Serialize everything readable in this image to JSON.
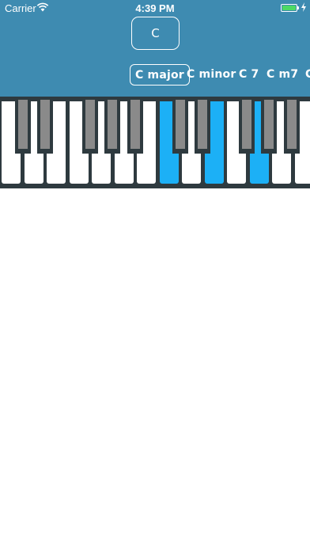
{
  "status_bar": {
    "carrier": "Carrier",
    "time": "4:39 PM",
    "battery_color": "#4cd964"
  },
  "root_note": {
    "label": "C"
  },
  "chord_types": [
    {
      "label": "C major",
      "selected": true
    },
    {
      "label": "C minor",
      "selected": false
    },
    {
      "label": "C 7",
      "selected": false
    },
    {
      "label": "C m7",
      "selected": false
    },
    {
      "label": "C",
      "selected": false
    }
  ],
  "piano": {
    "highlight_color": "#1cb0f6",
    "white_keys": [
      "C",
      "D",
      "E",
      "F",
      "G",
      "A",
      "B",
      "C",
      "D",
      "E",
      "F",
      "G",
      "A",
      "B"
    ],
    "highlighted_white_keys": [
      "C",
      "E",
      "G"
    ],
    "black_keys": [
      "C#",
      "D#",
      "F#",
      "G#",
      "A#",
      "C#",
      "D#",
      "F#",
      "G#",
      "A#"
    ]
  },
  "colors": {
    "header_bg": "#3e8bb1",
    "piano_frame": "#2e3a3f",
    "black_key": "#8a8a8a"
  }
}
